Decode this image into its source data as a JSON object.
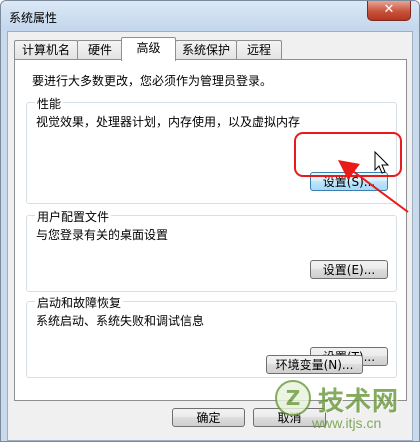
{
  "window": {
    "title": "系统属性"
  },
  "tabs": [
    {
      "label": "计算机名"
    },
    {
      "label": "硬件"
    },
    {
      "label": "高级"
    },
    {
      "label": "系统保护"
    },
    {
      "label": "远程"
    }
  ],
  "intro_text": "要进行大多数更改，您必须作为管理员登录。",
  "groups": {
    "performance": {
      "label": "性能",
      "desc": "视觉效果，处理器计划，内存使用，以及虚拟内存",
      "button": "设置(S)..."
    },
    "profile": {
      "label": "用户配置文件",
      "desc": "与您登录有关的桌面设置",
      "button": "设置(E)..."
    },
    "startup": {
      "label": "启动和故障恢复",
      "desc": "系统启动、系统失败和调试信息",
      "button": "设置(T)..."
    }
  },
  "env_button": "环境变量(N)...",
  "footer": {
    "ok": "确定",
    "cancel": "取消"
  },
  "watermark": {
    "logo_char": "Z",
    "text": "技术网",
    "url": "www.itjs.cn"
  },
  "colors": {
    "highlight": "#e81a1a",
    "watermark": "#6a9a3c"
  }
}
